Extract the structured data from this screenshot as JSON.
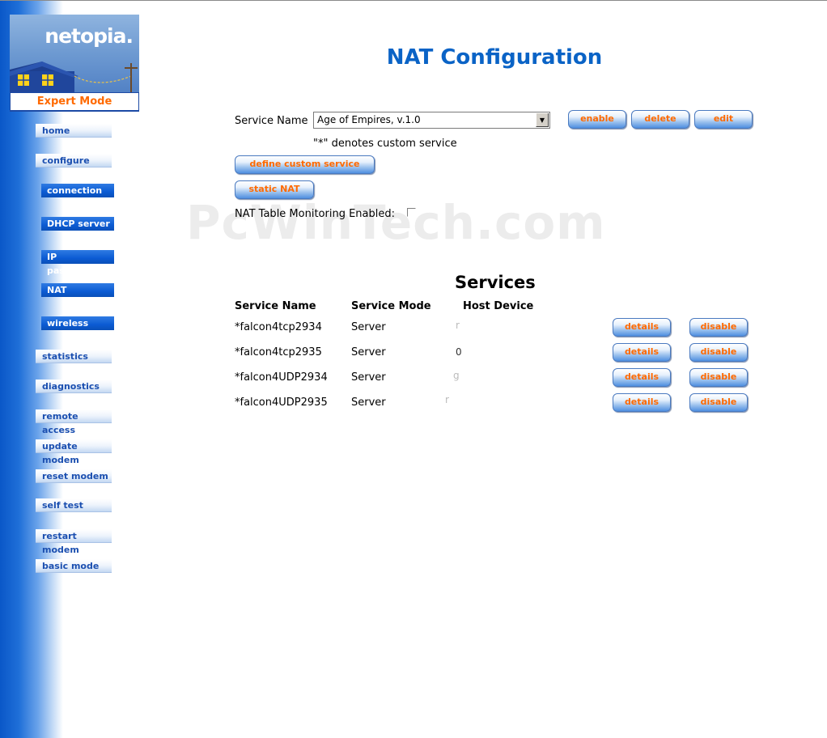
{
  "logo": {
    "brand": "netopia.",
    "mode": "Expert Mode"
  },
  "nav": {
    "main": [
      {
        "name": "nav-home",
        "label": "home"
      },
      {
        "name": "nav-configure",
        "label": "configure"
      }
    ],
    "sub": [
      {
        "name": "nav-connection",
        "label": "connection"
      },
      {
        "name": "nav-dhcp-server",
        "label": "DHCP server"
      },
      {
        "name": "nav-ip-passthrough",
        "label": "IP passthrough"
      },
      {
        "name": "nav-nat",
        "label": "NAT"
      },
      {
        "name": "nav-wireless",
        "label": "wireless"
      }
    ],
    "lower": [
      {
        "name": "nav-statistics",
        "label": "statistics"
      },
      {
        "name": "nav-diagnostics",
        "label": "diagnostics"
      },
      {
        "name": "nav-remote-access",
        "label": "remote access"
      },
      {
        "name": "nav-update-modem",
        "label": "update modem"
      },
      {
        "name": "nav-reset-modem",
        "label": "reset modem"
      },
      {
        "name": "nav-self-test",
        "label": "self test"
      },
      {
        "name": "nav-restart-modem",
        "label": "restart modem"
      },
      {
        "name": "nav-basic-mode",
        "label": "basic mode"
      }
    ]
  },
  "page": {
    "title": "NAT Configuration",
    "service_name_label": "Service Name",
    "service_select_value": "Age of Empires, v.1.0",
    "enable_label": "enable",
    "delete_label": "delete",
    "edit_label": "edit",
    "custom_note": "\"*\" denotes custom service",
    "define_custom_label": "define custom service",
    "static_nat_label": "static NAT",
    "monitoring_label": "NAT Table Monitoring Enabled:",
    "monitoring_enabled": false,
    "watermark": "PcWinTech.com"
  },
  "services": {
    "title": "Services",
    "headers": {
      "name": "Service Name",
      "mode": "Service Mode",
      "host": "Host Device"
    },
    "details_label": "details",
    "disable_label": "disable",
    "rows": [
      {
        "name": "*falcon4tcp2934",
        "mode": "Server",
        "host": "r"
      },
      {
        "name": "*falcon4tcp2935",
        "mode": "Server",
        "host": "0"
      },
      {
        "name": "*falcon4UDP2934",
        "mode": "Server",
        "host": "g"
      },
      {
        "name": "*falcon4UDP2935",
        "mode": "Server",
        "host": "r"
      }
    ]
  }
}
